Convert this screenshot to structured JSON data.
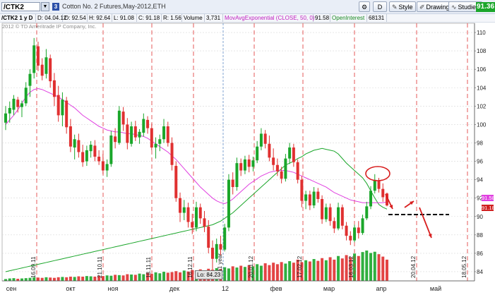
{
  "toolbar": {
    "symbol": "/CTK2",
    "symbol_badge": "3",
    "description": "Cotton No. 2 Futures,May-2012,ETH",
    "buttons": {
      "d": "D",
      "style": "Style",
      "drawings": "Drawings",
      "studies": "Studies"
    },
    "last_price": "91.36"
  },
  "infobar": {
    "chart_id": "/CTK2 1 y D",
    "date": "D: 04.04.12",
    "open": "O: 92.54",
    "high": "H: 92.64",
    "low": "L: 91.08",
    "close": "C: 91.18",
    "range": "R: 1.56",
    "volume_label": "Volume",
    "volume_value": "3,731",
    "ma_label": "MovAvgExponential (CLOSE, 50, 0)",
    "ma_value": "91.58",
    "oi_label": "OpenInterest",
    "oi_value": "68131"
  },
  "copyright": "2012 © TD Ameritrade IP Company, Inc.",
  "low_marker": "Lo: 84.23",
  "price_tags": [
    {
      "value": "91.58",
      "color": "#e040e0"
    },
    {
      "value": "91.18",
      "color": "#d02020"
    }
  ],
  "chart_data": {
    "type": "candlestick",
    "ylim": [
      83,
      111
    ],
    "y_ticks": [
      "84",
      "86",
      "88",
      "90",
      "92",
      "94",
      "96",
      "98",
      "100",
      "102",
      "104",
      "106",
      "108",
      "110"
    ],
    "x_months": [
      "сен",
      "окт",
      "ноя",
      "дек",
      "12",
      "фев",
      "мар",
      "апр",
      "май"
    ],
    "expiration_labels": [
      "16.09.11",
      "21.10.11",
      "18.11.11",
      "16.12.11",
      "2011 year",
      "20.01.12",
      "17.02.12",
      "16.03.12",
      "20.04.12",
      "18.05.12"
    ],
    "colors": {
      "up": "#1aa62a",
      "down": "#d91e1e",
      "ma": "#e040e0",
      "oi": "#1aa62a",
      "grid": "#d8d8d8",
      "expiry": "#e03030",
      "year": "#4a7dbf"
    },
    "series": [
      {
        "name": "Cotton No. 2 Futures,May-2012,ETH",
        "candles_ohlc": [
          [
            100.2,
            102.0,
            99.4,
            101.2
          ],
          [
            101.2,
            102.5,
            100.2,
            101.8
          ],
          [
            101.6,
            103.2,
            101.0,
            102.8
          ],
          [
            102.7,
            103.0,
            101.3,
            101.9
          ],
          [
            101.9,
            102.6,
            100.8,
            102.3
          ],
          [
            102.3,
            104.6,
            102.0,
            104.0
          ],
          [
            104.2,
            106.0,
            103.0,
            105.5
          ],
          [
            105.6,
            109.4,
            105.0,
            108.6
          ],
          [
            108.5,
            109.0,
            105.8,
            106.4
          ],
          [
            106.5,
            107.2,
            104.8,
            105.3
          ],
          [
            105.5,
            108.2,
            105.0,
            107.3
          ],
          [
            107.2,
            107.6,
            104.0,
            104.7
          ],
          [
            104.8,
            105.6,
            102.0,
            103.0
          ],
          [
            103.2,
            104.2,
            100.3,
            101.0
          ],
          [
            101.0,
            103.5,
            99.8,
            102.7
          ],
          [
            102.6,
            103.0,
            99.0,
            99.7
          ],
          [
            99.8,
            100.6,
            97.0,
            97.6
          ],
          [
            97.5,
            98.9,
            96.2,
            98.4
          ],
          [
            98.3,
            99.0,
            96.4,
            97.0
          ],
          [
            97.0,
            97.8,
            95.4,
            95.9
          ],
          [
            96.0,
            97.7,
            95.5,
            97.2
          ],
          [
            97.1,
            98.2,
            96.4,
            97.8
          ],
          [
            97.7,
            98.3,
            96.0,
            96.5
          ],
          [
            96.5,
            97.2,
            95.6,
            96.0
          ],
          [
            96.0,
            96.8,
            94.6,
            95.0
          ],
          [
            95.0,
            96.2,
            94.3,
            95.7
          ],
          [
            95.7,
            99.3,
            95.4,
            98.8
          ],
          [
            98.7,
            99.6,
            97.4,
            98.1
          ],
          [
            98.0,
            102.0,
            97.8,
            101.5
          ],
          [
            101.4,
            101.9,
            99.3,
            100.0
          ],
          [
            100.0,
            100.7,
            97.3,
            98.0
          ],
          [
            97.9,
            100.3,
            97.6,
            99.8
          ],
          [
            99.8,
            100.4,
            98.2,
            98.6
          ],
          [
            98.6,
            99.5,
            97.9,
            99.2
          ],
          [
            99.1,
            101.2,
            98.7,
            100.6
          ],
          [
            100.5,
            100.9,
            99.0,
            99.6
          ],
          [
            99.6,
            100.1,
            97.2,
            97.5
          ],
          [
            97.5,
            98.6,
            96.3,
            97.9
          ],
          [
            97.9,
            98.9,
            97.1,
            98.4
          ],
          [
            98.4,
            100.6,
            98.0,
            99.8
          ],
          [
            99.8,
            100.3,
            97.6,
            98.0
          ],
          [
            98.0,
            98.6,
            95.0,
            95.6
          ],
          [
            95.5,
            96.0,
            91.6,
            92.0
          ],
          [
            92.0,
            92.6,
            89.4,
            90.4
          ],
          [
            90.4,
            91.8,
            89.6,
            91.0
          ],
          [
            91.0,
            91.5,
            88.8,
            89.4
          ],
          [
            89.4,
            90.3,
            88.1,
            88.8
          ],
          [
            88.8,
            91.6,
            88.4,
            91.0
          ],
          [
            91.0,
            91.4,
            89.2,
            89.8
          ],
          [
            89.8,
            90.6,
            88.3,
            88.9
          ],
          [
            88.9,
            89.6,
            86.0,
            86.6
          ],
          [
            86.6,
            87.4,
            84.23,
            85.4
          ],
          [
            85.4,
            87.6,
            85.0,
            87.0
          ],
          [
            87.0,
            87.9,
            85.8,
            86.4
          ],
          [
            86.4,
            89.2,
            86.2,
            88.8
          ],
          [
            88.8,
            94.6,
            88.4,
            94.0
          ],
          [
            94.0,
            94.8,
            92.4,
            93.2
          ],
          [
            93.2,
            96.4,
            92.8,
            95.8
          ],
          [
            95.8,
            96.3,
            94.4,
            95.0
          ],
          [
            95.0,
            96.6,
            94.6,
            96.2
          ],
          [
            96.2,
            96.7,
            94.8,
            95.4
          ],
          [
            95.4,
            96.5,
            94.9,
            96.1
          ],
          [
            96.1,
            98.2,
            95.8,
            97.6
          ],
          [
            97.6,
            99.6,
            97.2,
            99.0
          ],
          [
            99.0,
            99.4,
            97.4,
            97.9
          ],
          [
            97.9,
            98.8,
            96.0,
            96.4
          ],
          [
            96.4,
            97.4,
            95.0,
            95.6
          ],
          [
            95.6,
            96.3,
            94.4,
            94.9
          ],
          [
            94.9,
            95.4,
            93.6,
            94.1
          ],
          [
            94.1,
            96.8,
            93.8,
            96.3
          ],
          [
            96.3,
            98.0,
            95.7,
            97.5
          ],
          [
            97.5,
            97.9,
            95.4,
            95.9
          ],
          [
            95.9,
            96.2,
            93.6,
            94.0
          ],
          [
            94.0,
            94.4,
            91.0,
            91.7
          ],
          [
            91.7,
            92.8,
            90.8,
            92.4
          ],
          [
            92.4,
            92.8,
            90.7,
            91.2
          ],
          [
            91.2,
            93.2,
            90.9,
            92.7
          ],
          [
            92.7,
            93.1,
            91.5,
            91.9
          ],
          [
            91.9,
            92.3,
            89.2,
            89.7
          ],
          [
            89.7,
            91.4,
            89.4,
            91.0
          ],
          [
            91.0,
            91.4,
            89.0,
            89.5
          ],
          [
            89.5,
            89.9,
            88.2,
            88.7
          ],
          [
            88.7,
            91.5,
            88.5,
            91.0
          ],
          [
            91.0,
            91.3,
            88.6,
            89.0
          ],
          [
            89.0,
            89.4,
            87.4,
            87.9
          ],
          [
            87.9,
            88.4,
            86.9,
            87.4
          ],
          [
            87.4,
            89.1,
            87.2,
            88.8
          ],
          [
            88.8,
            89.5,
            87.6,
            88.2
          ],
          [
            88.2,
            90.2,
            88.0,
            89.8
          ],
          [
            89.8,
            91.6,
            89.6,
            91.1
          ],
          [
            91.1,
            93.3,
            90.8,
            92.8
          ],
          [
            92.8,
            94.6,
            92.5,
            93.9
          ],
          [
            93.9,
            94.2,
            92.6,
            93.0
          ],
          [
            93.0,
            93.6,
            91.6,
            92.1
          ],
          [
            92.5,
            92.6,
            91.1,
            91.2
          ]
        ],
        "ma_ema50": [
          100.0,
          100.5,
          101.0,
          101.6,
          102.3,
          103.0,
          103.5,
          103.8,
          103.9,
          103.8,
          103.6,
          103.4,
          103.2,
          103.0,
          102.7,
          102.4,
          102.1,
          101.8,
          101.4,
          101.0,
          100.7,
          100.4,
          100.1,
          99.8,
          99.6,
          99.4,
          99.3,
          99.2,
          99.2,
          99.1,
          99.0,
          99.0,
          98.9,
          98.8,
          98.7,
          98.5,
          98.2,
          97.9,
          97.6,
          97.3,
          97.0,
          96.6,
          96.2,
          95.7,
          95.2,
          94.7,
          94.2,
          93.7,
          93.2,
          92.8,
          92.4,
          92.0,
          91.7,
          91.5,
          91.4,
          91.6,
          91.9,
          92.3,
          92.7,
          93.1,
          93.5,
          93.8,
          94.1,
          94.4,
          94.6,
          94.8,
          94.9,
          95.0,
          95.0,
          95.0,
          94.9,
          94.8,
          94.6,
          94.4,
          94.2,
          94.0,
          93.8,
          93.6,
          93.4,
          93.2,
          92.9,
          92.6,
          92.4,
          92.2,
          92.0,
          91.8,
          91.7,
          91.6,
          91.5,
          91.5,
          91.5,
          91.5,
          91.5,
          91.5,
          91.58
        ],
        "open_interest": [
          84.0,
          84.1,
          84.2,
          84.3,
          84.4,
          84.5,
          84.6,
          84.7,
          84.8,
          84.9,
          85.0,
          85.1,
          85.2,
          85.3,
          85.4,
          85.5,
          85.6,
          85.7,
          85.8,
          85.9,
          86.0,
          86.1,
          86.2,
          86.3,
          86.4,
          86.5,
          86.6,
          86.7,
          86.8,
          86.9,
          87.0,
          87.1,
          87.2,
          87.3,
          87.4,
          87.5,
          87.6,
          87.7,
          87.8,
          87.9,
          88.0,
          88.1,
          88.2,
          88.3,
          88.4,
          88.5,
          88.6,
          88.7,
          88.8,
          88.9,
          89.0,
          89.1,
          89.3,
          89.5,
          89.8,
          90.1,
          90.4,
          90.8,
          91.2,
          91.6,
          92.0,
          92.4,
          92.8,
          93.2,
          93.6,
          94.0,
          94.4,
          94.8,
          95.2,
          95.6,
          95.8,
          96.0,
          96.3,
          96.5,
          96.8,
          97.0,
          97.2,
          97.3,
          97.4,
          97.3,
          97.2,
          97.1,
          96.8,
          96.3,
          95.8,
          95.4,
          95.0,
          94.6,
          94.2,
          93.6,
          92.8,
          92.0,
          91.3,
          91.0,
          90.8
        ],
        "volume_rel": [
          0.06,
          0.08,
          0.09,
          0.07,
          0.08,
          0.09,
          0.1,
          0.12,
          0.11,
          0.1,
          0.12,
          0.11,
          0.1,
          0.12,
          0.13,
          0.12,
          0.14,
          0.13,
          0.15,
          0.14,
          0.16,
          0.15,
          0.14,
          0.17,
          0.16,
          0.18,
          0.17,
          0.2,
          0.19,
          0.18,
          0.22,
          0.21,
          0.2,
          0.24,
          0.22,
          0.26,
          0.23,
          0.28,
          0.25,
          0.3,
          0.27,
          0.29,
          0.32,
          0.28,
          0.34,
          0.31,
          0.36,
          0.33,
          0.38,
          0.35,
          0.4,
          0.37,
          0.42,
          0.39,
          0.45,
          0.41,
          0.48,
          0.44,
          0.5,
          0.46,
          0.52,
          0.48,
          0.55,
          0.5,
          0.58,
          0.52,
          0.6,
          0.55,
          0.62,
          0.57,
          0.65,
          0.6,
          0.7,
          0.62,
          0.68,
          0.64,
          0.72,
          0.66,
          0.75,
          0.68,
          0.78,
          0.7,
          0.82,
          0.74,
          0.85,
          0.78,
          0.9,
          0.82,
          0.95,
          1.0,
          0.92,
          0.96,
          0.88,
          0.8,
          0.7
        ]
      }
    ]
  }
}
